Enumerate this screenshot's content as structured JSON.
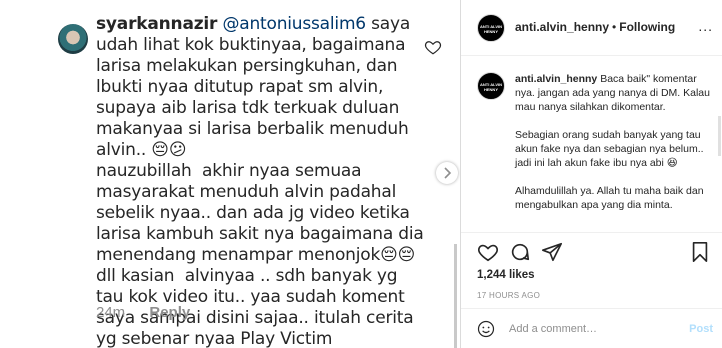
{
  "left": {
    "username": "syarkannazir",
    "mention": "@antoniussalim6",
    "comment": "saya udah lihat kok buktinyaa, bagaimana larisa melakukan persingkuhan, dan lbukti nyaa ditutup rapat sm alvin, supaya aib larisa tdk terkuak duluan makanyaa si larisa berbalik menuduh alvin.. 😔😕\nnauzubillah  akhir nyaa semuaa masyarakat menuduh alvin padahal sebelik nyaa.. dan ada jg video ketika larisa kambuh sakit nya bagaimana dia menendang menampar menonjok😔😔\ndll kasian  alvinyaa .. sdh banyak yg  tau kok video itu.. yaa sudah koment saya sampai disini sajaa.. itulah cerita yg sebenar nyaa Play Victim",
    "time": "24m",
    "reply": "Reply"
  },
  "post": {
    "avatar_text": "ANTI ALVIN HENNY",
    "username": "anti.alvin_henny",
    "separator": "•",
    "follow": "Following",
    "more": "...",
    "caption_user": "anti.alvin_henny",
    "caption_p1": "Baca baik\" komentar nya. jangan ada yang nanya di DM. Kalau mau nanya silahkan dikomentar.",
    "caption_p2": "Sebagian orang sudah banyak yang tau akun fake nya dan sebagian nya belum.. jadi ini lah akun fake ibu nya abi 😆",
    "caption_p3": "Alhamdulillah ya. Allah tu maha baik dan mengabulkan apa yang dia minta.",
    "likes": "1,244 likes",
    "time": "17 HOURS AGO",
    "add_placeholder": "Add a comment…",
    "post_label": "Post"
  }
}
